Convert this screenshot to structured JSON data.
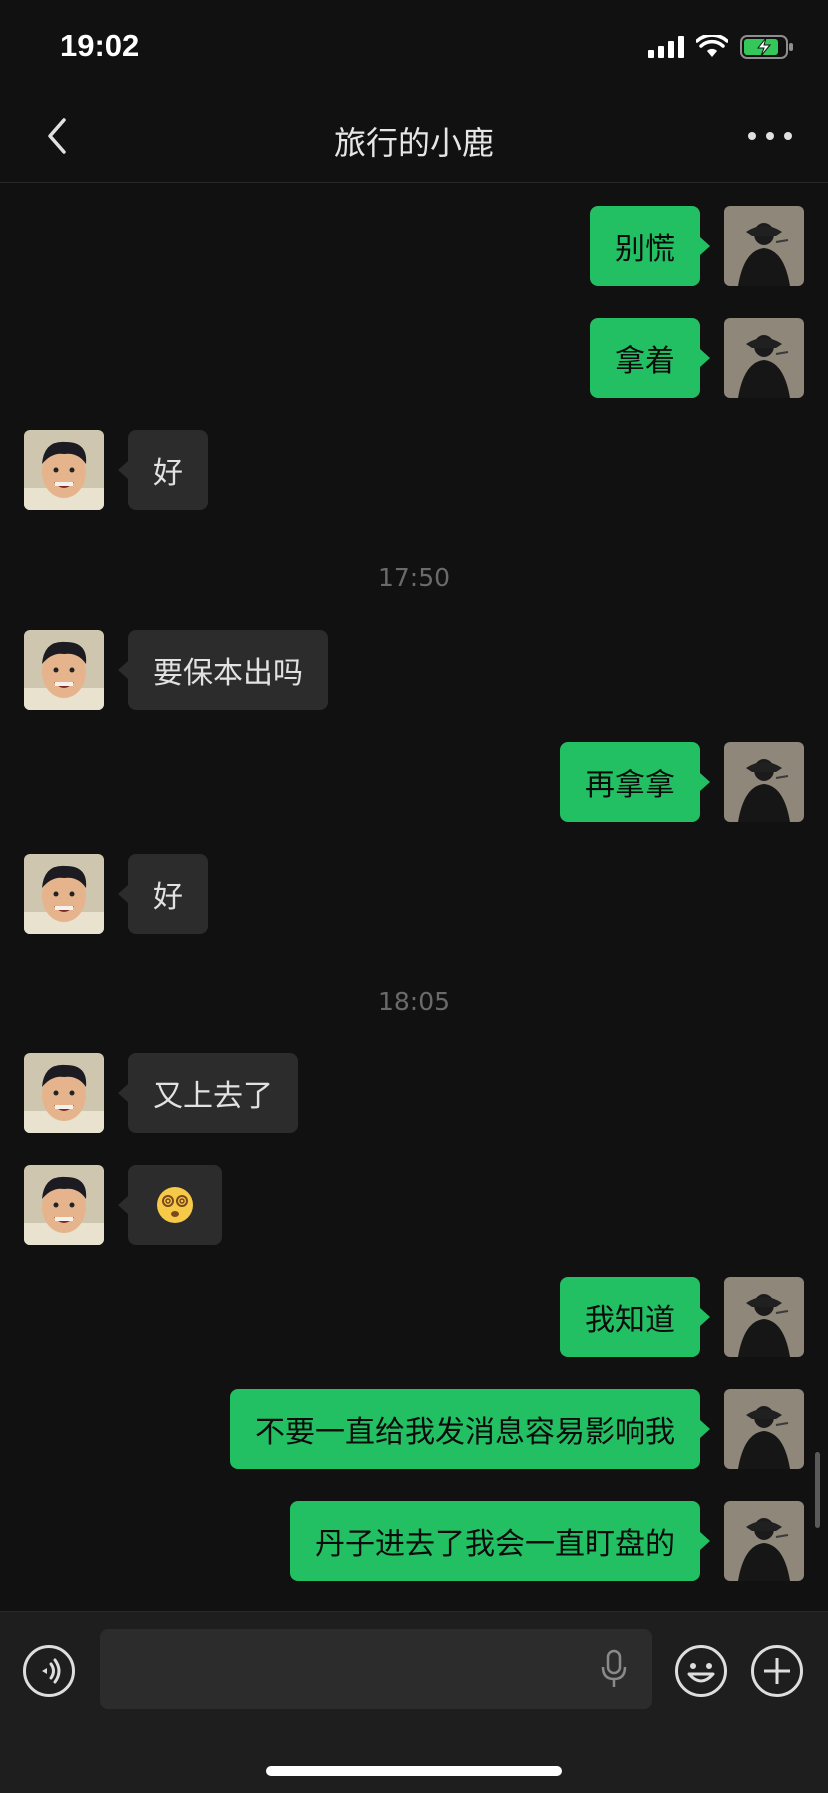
{
  "status": {
    "time": "19:02"
  },
  "nav": {
    "title": "旅行的小鹿"
  },
  "messages": [
    {
      "side": "me",
      "text": "别慌"
    },
    {
      "side": "me",
      "text": "拿着"
    },
    {
      "side": "them",
      "text": "好"
    },
    {
      "side": "timestamp",
      "text": "17:50"
    },
    {
      "side": "them",
      "text": "要保本出吗"
    },
    {
      "side": "me",
      "text": "再拿拿"
    },
    {
      "side": "them",
      "text": "好"
    },
    {
      "side": "timestamp",
      "text": "18:05"
    },
    {
      "side": "them",
      "text": "又上去了"
    },
    {
      "side": "them",
      "text": "😵‍💫",
      "emoji": "dizzy-face"
    },
    {
      "side": "me",
      "text": "我知道"
    },
    {
      "side": "me",
      "text": "不要一直给我发消息容易影响我"
    },
    {
      "side": "me",
      "text": "丹子进去了我会一直盯盘的"
    }
  ],
  "colors": {
    "background": "#111111",
    "bubble_me": "#22c063",
    "bubble_them": "#2c2c2c",
    "input_bar": "#1e1e1e",
    "battery_charging": "#34c759"
  },
  "icons": {
    "back": "chevron-left-icon",
    "more": "more-dots-icon",
    "voice": "voice-icon",
    "mic": "microphone-icon",
    "emoji": "emoji-icon",
    "add": "plus-icon"
  }
}
